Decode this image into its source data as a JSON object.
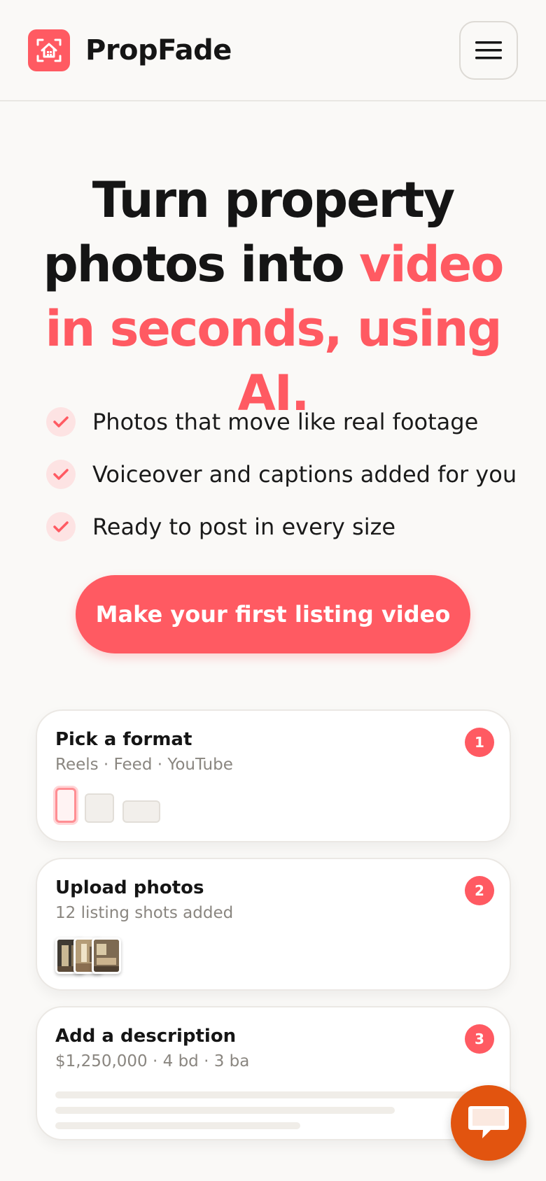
{
  "app": {
    "name": "PropFade"
  },
  "colors": {
    "accent": "#ff5a62",
    "chat": "#e2540f"
  },
  "hero": {
    "title_part1": "Turn property photos into ",
    "title_accent": "video in seconds, using AI."
  },
  "features": [
    {
      "icon": "check-icon",
      "text": "Photos that move like real footage"
    },
    {
      "icon": "check-icon",
      "text": "Voiceover and captions added for you"
    },
    {
      "icon": "check-icon",
      "text": "Ready to post in every size"
    }
  ],
  "cta": {
    "label": "Make your first listing video"
  },
  "steps": [
    {
      "number": "1",
      "title": "Pick a format",
      "subtitle": "Reels · Feed · YouTube"
    },
    {
      "number": "2",
      "title": "Upload photos",
      "subtitle": "12 listing shots added"
    },
    {
      "number": "3",
      "title": "Add a description",
      "subtitle": "$1,250,000 · 4 bd · 3 ba"
    }
  ],
  "icons": {
    "logo": "house-frame-logo-icon",
    "menu": "hamburger-menu-icon",
    "chat": "chat-bubble-icon"
  }
}
